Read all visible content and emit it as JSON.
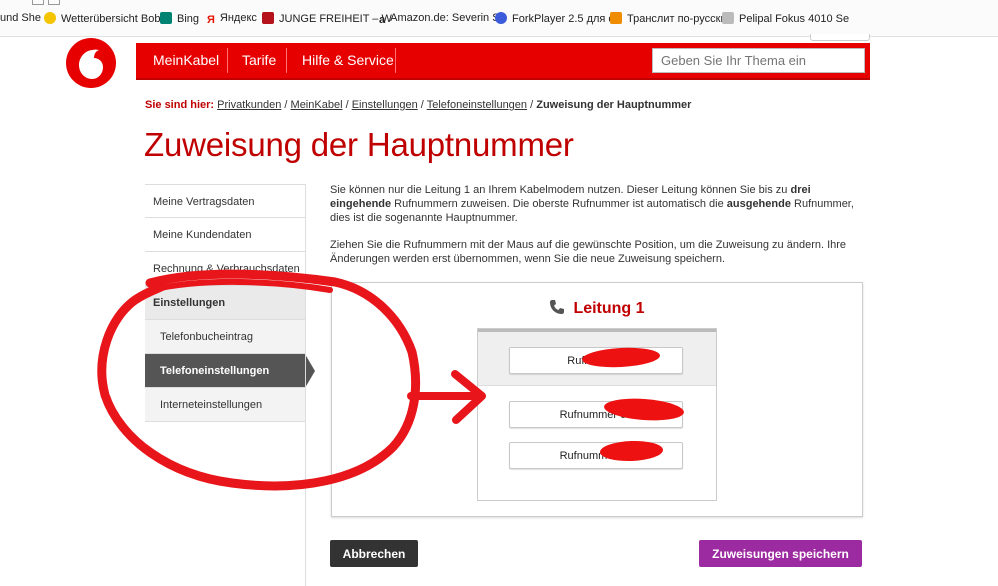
{
  "bookmarks": [
    {
      "label": "und She",
      "icon": "bookmark-icon",
      "color": "#777777"
    },
    {
      "label": "Wetterübersicht Bobi",
      "icon": "sun-icon",
      "color": "#f5c400"
    },
    {
      "label": "Bing",
      "icon": "bing-icon",
      "color": "#008373"
    },
    {
      "label": "Яндекс",
      "icon": "yandex-icon",
      "color": "#e61400"
    },
    {
      "label": "JUNGE FREIHEIT – W",
      "icon": "jf-icon",
      "color": "#b5121b"
    },
    {
      "label": "Amazon.de: Severin S",
      "icon": "amazon-icon",
      "color": "#222222"
    },
    {
      "label": "ForkPlayer 2.5 для см",
      "icon": "forkplayer-icon",
      "color": "#3b5bdb"
    },
    {
      "label": "Транслит по-русски",
      "icon": "translit-icon",
      "color": "#f08c00"
    },
    {
      "label": "Pelipal Fokus 4010 Se",
      "icon": "pelipal-icon",
      "color": "#888888"
    }
  ],
  "header": {
    "nav": [
      "MeinKabel",
      "Tarife",
      "Hilfe & Service"
    ],
    "search_placeholder": "Geben Sie Ihr Thema ein",
    "brand_color": "#e60000"
  },
  "breadcrumb": {
    "label": "Sie sind hier:",
    "items": [
      "Privatkunden",
      "MeinKabel",
      "Einstellungen",
      "Telefoneinstellungen"
    ],
    "current": "Zuweisung der Hauptnummer"
  },
  "page_title": "Zuweisung der Hauptnummer",
  "sidebar": {
    "items": [
      "Meine Vertragsdaten",
      "Meine Kundendaten",
      "Rechnung & Verbrauchsdaten"
    ],
    "group": "Einstellungen",
    "sub": [
      "Telefonbucheintrag",
      "Telefoneinstellungen",
      "Interneteinstellungen"
    ]
  },
  "intro": {
    "p1_a": "Sie können nur die Leitung 1 an Ihrem Kabelmodem nutzen. Dieser Leitung können Sie bis zu ",
    "p1_b1": "drei eingehende",
    "p1_c": " Rufnummern zuweisen. Die oberste Rufnummer ist automatisch die ",
    "p1_b2": "ausgehende",
    "p1_d": " Rufnummer, dies ist die sogenannte Hauptnummer.",
    "p2": "Ziehen Sie die Rufnummern mit der Maus auf die gewünschte Position, um die Zuweisung zu ändern. Ihre Änderungen werden erst übernommen, wenn Sie die neue Zuweisung speichern."
  },
  "panel": {
    "title": "Leitung 1",
    "numbers": [
      "Rufnummer",
      "Rufnummer 08",
      "Rufnummer 08"
    ]
  },
  "buttons": {
    "cancel": "Abbrechen",
    "save": "Zuweisungen speichern",
    "save_color": "#9c2aa0"
  },
  "annotation_color": "#e8161b"
}
